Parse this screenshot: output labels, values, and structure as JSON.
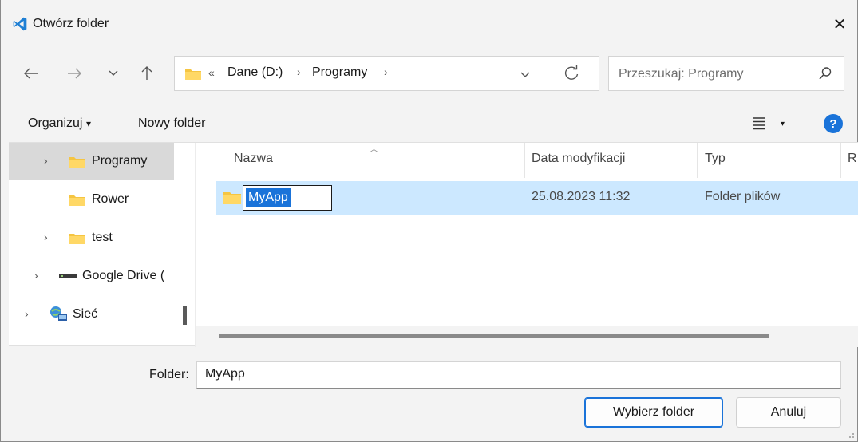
{
  "window": {
    "title": "Otwórz folder",
    "close_glyph": "✕"
  },
  "nav": {
    "back_glyph": "←",
    "forward_glyph": "→",
    "recent_glyph": "⌄",
    "up_glyph": "↑"
  },
  "address": {
    "overflow_glyph": "«",
    "segments": [
      "Dane (D:)",
      "Programy"
    ],
    "separator_glyph": "›"
  },
  "search": {
    "placeholder": "Przeszukaj: Programy"
  },
  "toolbar": {
    "organize_label": "Organizuj",
    "organize_caret": "▾",
    "new_folder_label": "Nowy folder",
    "view_caret": "▾",
    "help_glyph": "?"
  },
  "navpane": {
    "items": [
      {
        "label": "Programy",
        "chevron": "›"
      },
      {
        "label": "Rower"
      },
      {
        "label": "test",
        "chevron": "›"
      },
      {
        "label": "Google Drive (",
        "chevron": "›"
      },
      {
        "label": "Sieć",
        "chevron": "›"
      }
    ]
  },
  "files": {
    "columns": [
      "Nazwa",
      "Data modyfikacji",
      "Typ",
      "R"
    ],
    "sort_glyph": "︿",
    "rows": [
      {
        "name": "MyApp",
        "modified": "25.08.2023 11:32",
        "type": "Folder plików"
      }
    ]
  },
  "bottom": {
    "folder_label": "Folder:",
    "folder_value": "MyApp",
    "select_button": "Wybierz folder",
    "cancel_button": "Anuluj"
  },
  "colors": {
    "accent": "#1a73d9",
    "selection": "#cce8ff",
    "folder_yellow": "#f5c542",
    "vscode_blue": "#1e7fd4"
  },
  "icons": [
    "vscode-icon",
    "close-icon",
    "back-arrow-icon",
    "forward-arrow-icon",
    "chevron-down-icon",
    "up-arrow-icon",
    "folder-icon",
    "refresh-icon",
    "search-icon",
    "view-list-icon",
    "help-icon",
    "drive-icon",
    "network-icon"
  ]
}
